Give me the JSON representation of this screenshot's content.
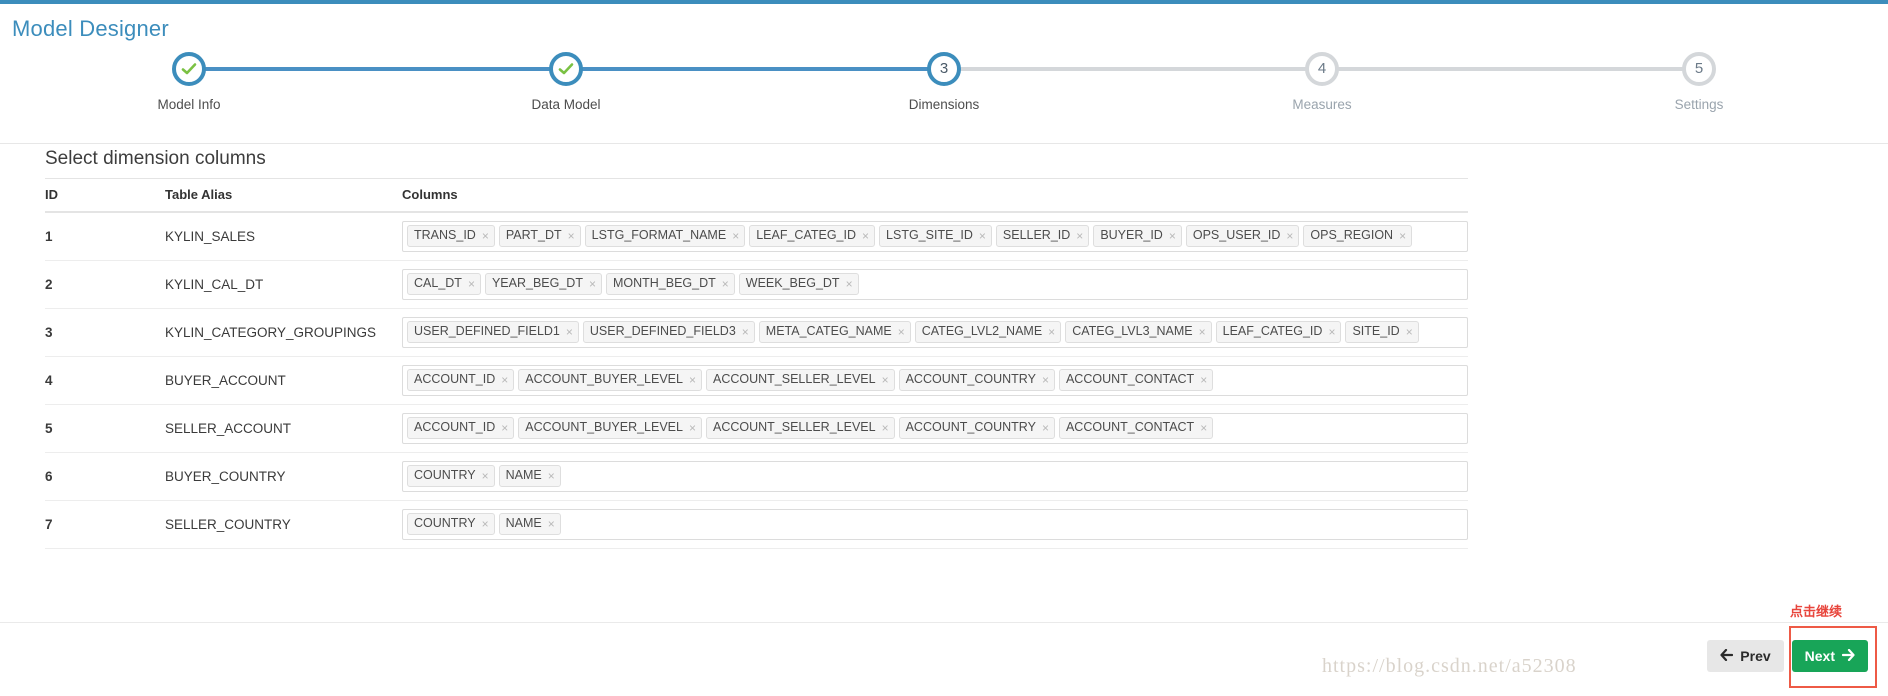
{
  "header": {
    "title": "Model Designer",
    "accent_color": "#3c8dbc"
  },
  "stepper": {
    "steps": [
      {
        "number": "1",
        "label": "Model Info",
        "state": "done"
      },
      {
        "number": "2",
        "label": "Data Model",
        "state": "done"
      },
      {
        "number": "3",
        "label": "Dimensions",
        "state": "active"
      },
      {
        "number": "4",
        "label": "Measures",
        "state": "todo"
      },
      {
        "number": "5",
        "label": "Settings",
        "state": "todo"
      }
    ],
    "active_color": "#3c8dbc",
    "inactive_color": "#d4d7da",
    "check_color": "#7ac143"
  },
  "main": {
    "section_title": "Select dimension columns",
    "table": {
      "headers": [
        "ID",
        "Table Alias",
        "Columns"
      ],
      "rows": [
        {
          "id": "1",
          "alias": "KYLIN_SALES",
          "columns": [
            "TRANS_ID",
            "PART_DT",
            "LSTG_FORMAT_NAME",
            "LEAF_CATEG_ID",
            "LSTG_SITE_ID",
            "SELLER_ID",
            "BUYER_ID",
            "OPS_USER_ID",
            "OPS_REGION"
          ]
        },
        {
          "id": "2",
          "alias": "KYLIN_CAL_DT",
          "columns": [
            "CAL_DT",
            "YEAR_BEG_DT",
            "MONTH_BEG_DT",
            "WEEK_BEG_DT"
          ]
        },
        {
          "id": "3",
          "alias": "KYLIN_CATEGORY_GROUPINGS",
          "columns": [
            "USER_DEFINED_FIELD1",
            "USER_DEFINED_FIELD3",
            "META_CATEG_NAME",
            "CATEG_LVL2_NAME",
            "CATEG_LVL3_NAME",
            "LEAF_CATEG_ID",
            "SITE_ID"
          ]
        },
        {
          "id": "4",
          "alias": "BUYER_ACCOUNT",
          "columns": [
            "ACCOUNT_ID",
            "ACCOUNT_BUYER_LEVEL",
            "ACCOUNT_SELLER_LEVEL",
            "ACCOUNT_COUNTRY",
            "ACCOUNT_CONTACT"
          ]
        },
        {
          "id": "5",
          "alias": "SELLER_ACCOUNT",
          "columns": [
            "ACCOUNT_ID",
            "ACCOUNT_BUYER_LEVEL",
            "ACCOUNT_SELLER_LEVEL",
            "ACCOUNT_COUNTRY",
            "ACCOUNT_CONTACT"
          ]
        },
        {
          "id": "6",
          "alias": "BUYER_COUNTRY",
          "columns": [
            "COUNTRY",
            "NAME"
          ]
        },
        {
          "id": "7",
          "alias": "SELLER_COUNTRY",
          "columns": [
            "COUNTRY",
            "NAME"
          ]
        }
      ],
      "tag_remove_glyph": "×"
    }
  },
  "footer": {
    "prev_label": "Prev",
    "prev_icon": "arrow-left-icon",
    "next_label": "Next",
    "next_icon": "arrow-right-icon",
    "next_color": "#18a558"
  },
  "annotation": {
    "caption": "点击继续",
    "color": "#e8453c"
  },
  "watermark": {
    "text": "https://blog.csdn.net/a52308"
  }
}
